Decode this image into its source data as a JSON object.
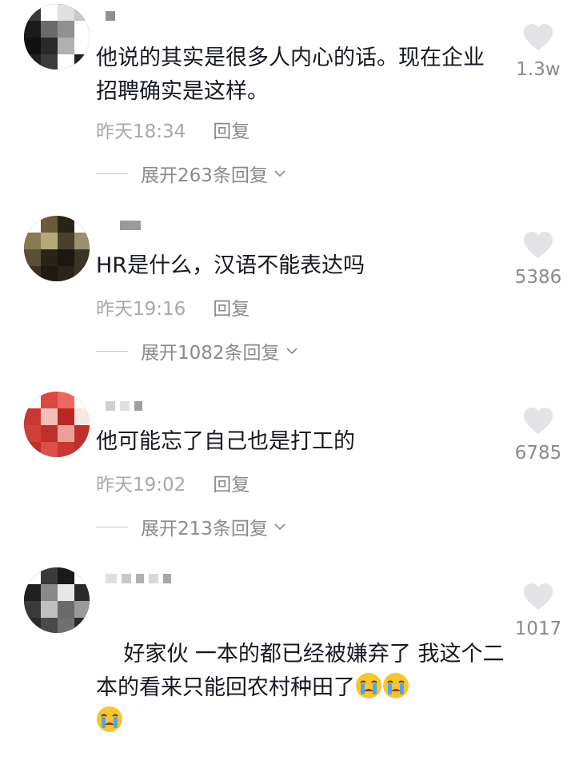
{
  "comments": [
    {
      "text": "他说的其实是很多人内心的话。现在企业招聘确实是这样。",
      "time": "昨天18:34",
      "reply_label": "回复",
      "expand_label": "展开263条回复",
      "likes": "1.3w"
    },
    {
      "text": "HR是什么，汉语不能表达吗",
      "time": "昨天19:16",
      "reply_label": "回复",
      "expand_label": "展开1082条回复",
      "likes": "5386"
    },
    {
      "text": "他可能忘了自己也是打工的",
      "time": "昨天19:02",
      "reply_label": "回复",
      "expand_label": "展开213条回复",
      "likes": "6785"
    },
    {
      "text": "好家伙 一本的都已经被嫌弃了 我这个二本的看来只能回农村种田了",
      "time": "",
      "reply_label": "",
      "expand_label": "",
      "likes": "1017",
      "emoji": [
        "loudly-crying-face",
        "loudly-crying-face",
        "loudly-crying-face"
      ]
    }
  ],
  "colors": {
    "text": "#161823",
    "meta": "#a8a8ac",
    "heart": "#e3e3e6"
  }
}
